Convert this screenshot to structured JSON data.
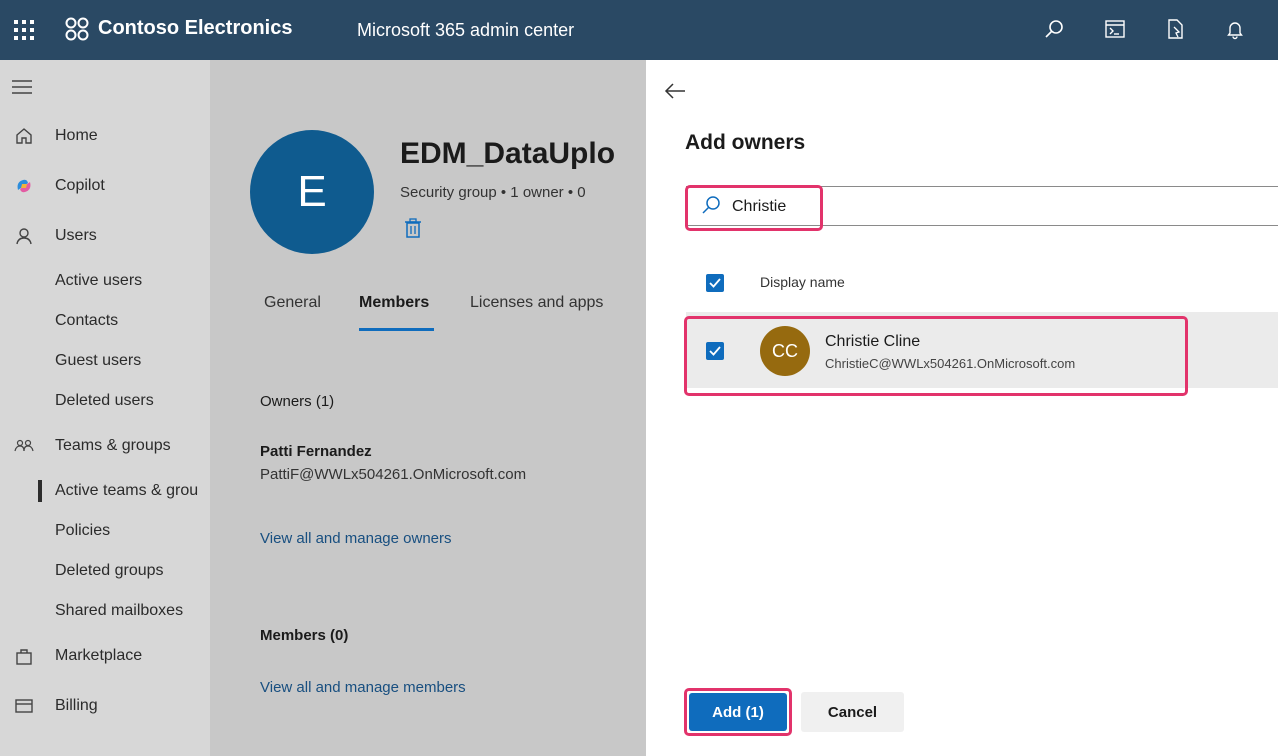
{
  "topbar": {
    "org_name": "Contoso Electronics",
    "app_name": "Microsoft 365 admin center",
    "icons": [
      "app-launcher-icon",
      "search-icon",
      "console-icon",
      "document-icon",
      "bell-icon"
    ]
  },
  "nav": {
    "items": [
      {
        "label": "Home",
        "icon": "home-icon"
      },
      {
        "label": "Copilot",
        "icon": "copilot-icon"
      },
      {
        "label": "Users",
        "icon": "user-icon"
      },
      {
        "label": "Active users"
      },
      {
        "label": "Contacts"
      },
      {
        "label": "Guest users"
      },
      {
        "label": "Deleted users"
      },
      {
        "label": "Teams & groups",
        "icon": "teams-icon"
      },
      {
        "label": "Active teams & grou"
      },
      {
        "label": "Policies"
      },
      {
        "label": "Deleted groups"
      },
      {
        "label": "Shared mailboxes"
      },
      {
        "label": "Marketplace",
        "icon": "bag-icon"
      },
      {
        "label": "Billing",
        "icon": "billing-icon"
      }
    ]
  },
  "group": {
    "avatar_letter": "E",
    "title": "EDM_DataUplo",
    "subtitle": "Security group  •  1 owner  •  0",
    "tabs": [
      "General",
      "Members",
      "Licenses and apps"
    ],
    "active_tab": "Members",
    "owners_heading": "Owners (1)",
    "owner_name": "Patti Fernandez",
    "owner_email": "PattiF@WWLx504261.OnMicrosoft.com",
    "manage_owners_link": "View all and manage owners",
    "members_heading": "Members (0)",
    "manage_members_link": "View all and manage members"
  },
  "panel": {
    "title": "Add owners",
    "search_value": "Christie",
    "column_header": "Display name",
    "result": {
      "initials": "CC",
      "name": "Christie Cline",
      "email": "ChristieC@WWLx504261.OnMicrosoft.com",
      "selected": true
    },
    "add_button": "Add (1)",
    "cancel_button": "Cancel"
  },
  "colors": {
    "topbar": "#2a4964",
    "accent": "#0f6cbd",
    "highlight": "#e2336b",
    "group_avatar": "#0f5b8f",
    "user_avatar": "#966a0f"
  }
}
